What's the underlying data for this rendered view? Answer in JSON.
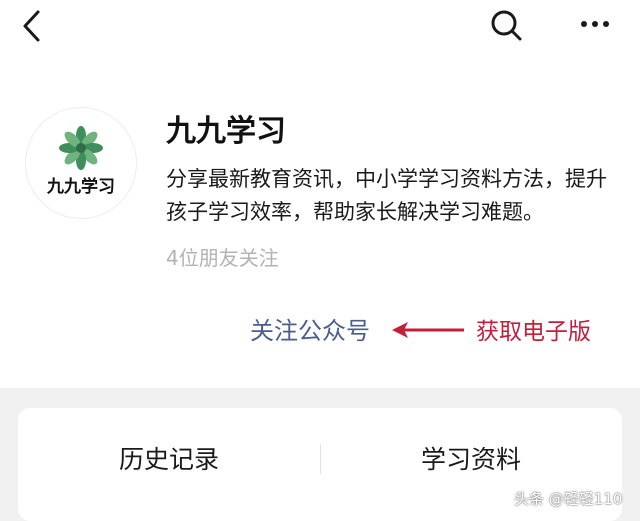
{
  "header": {
    "back_icon": "chevron-left-icon",
    "search_icon": "search-icon",
    "more_icon": "more-dots-icon"
  },
  "profile": {
    "avatar_text": "九九学习",
    "name": "九九学习",
    "description": "分享最新教育资讯，中小学学习资料方法，提升孩子学习效率，帮助家长解决学习难题。",
    "followers": "4位朋友关注",
    "follow_label": "关注公众号",
    "annotation": "获取电子版"
  },
  "menu": {
    "items": [
      {
        "label": "历史记录"
      },
      {
        "label": "学习资料"
      }
    ]
  },
  "watermark": "头条 @轻轻110",
  "colors": {
    "link": "#4a5d8c",
    "annotation": "#c21f3a",
    "muted": "#b3b3b3",
    "background_gray": "#f1f1f1",
    "logo_green": "#3e8f5c"
  }
}
